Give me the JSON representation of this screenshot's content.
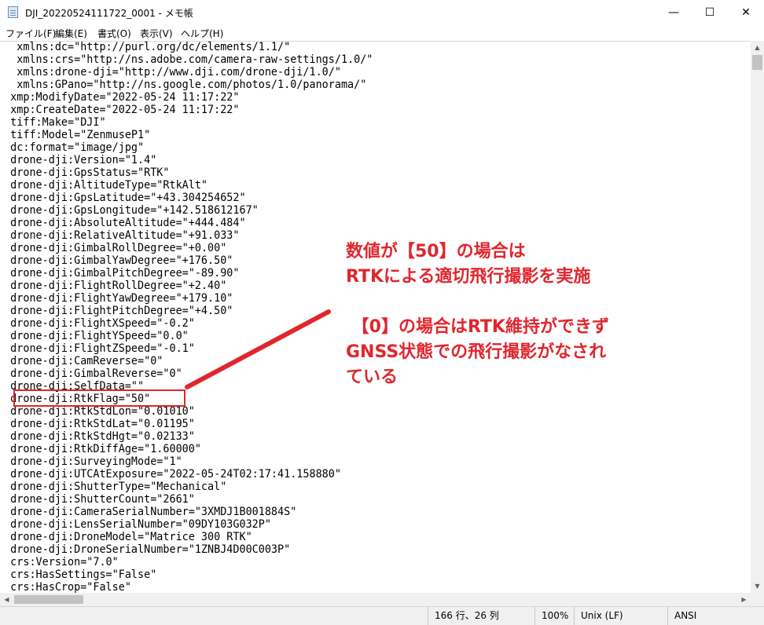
{
  "window": {
    "title": "DJI_20220524111722_0001 - メモ帳",
    "minimize_glyph": "—",
    "maximize_glyph": "☐",
    "close_glyph": "✕"
  },
  "menu": [
    {
      "label": "ファイル(F)"
    },
    {
      "label": "編集(E)"
    },
    {
      "label": "書式(O)"
    },
    {
      "label": "表示(V)"
    },
    {
      "label": "ヘルプ(H)"
    }
  ],
  "lines": [
    "   xmlns:dc=\"http://purl.org/dc/elements/1.1/\"",
    "   xmlns:crs=\"http://ns.adobe.com/camera-raw-settings/1.0/\"",
    "   xmlns:drone-dji=\"http://www.dji.com/drone-dji/1.0/\"",
    "   xmlns:GPano=\"http://ns.google.com/photos/1.0/panorama/\"",
    "  xmp:ModifyDate=\"2022-05-24 11:17:22\"",
    "  xmp:CreateDate=\"2022-05-24 11:17:22\"",
    "  tiff:Make=\"DJI\"",
    "  tiff:Model=\"ZenmuseP1\"",
    "  dc:format=\"image/jpg\"",
    "  drone-dji:Version=\"1.4\"",
    "  drone-dji:GpsStatus=\"RTK\"",
    "  drone-dji:AltitudeType=\"RtkAlt\"",
    "  drone-dji:GpsLatitude=\"+43.304254652\"",
    "  drone-dji:GpsLongitude=\"+142.518612167\"",
    "  drone-dji:AbsoluteAltitude=\"+444.484\"",
    "  drone-dji:RelativeAltitude=\"+91.033\"",
    "  drone-dji:GimbalRollDegree=\"+0.00\"",
    "  drone-dji:GimbalYawDegree=\"+176.50\"",
    "  drone-dji:GimbalPitchDegree=\"-89.90\"",
    "  drone-dji:FlightRollDegree=\"+2.40\"",
    "  drone-dji:FlightYawDegree=\"+179.10\"",
    "  drone-dji:FlightPitchDegree=\"+4.50\"",
    "  drone-dji:FlightXSpeed=\"-0.2\"",
    "  drone-dji:FlightYSpeed=\"0.0\"",
    "  drone-dji:FlightZSpeed=\"-0.1\"",
    "  drone-dji:CamReverse=\"0\"",
    "  drone-dji:GimbalReverse=\"0\"",
    "  drone-dji:SelfData=\"\"",
    "  drone-dji:RtkFlag=\"50\"",
    "  drone-dji:RtkStdLon=\"0.01010\"",
    "  drone-dji:RtkStdLat=\"0.01195\"",
    "  drone-dji:RtkStdHgt=\"0.02133\"",
    "  drone-dji:RtkDiffAge=\"1.60000\"",
    "  drone-dji:SurveyingMode=\"1\"",
    "  drone-dji:UTCAtExposure=\"2022-05-24T02:17:41.158880\"",
    "  drone-dji:ShutterType=\"Mechanical\"",
    "  drone-dji:ShutterCount=\"2661\"",
    "  drone-dji:CameraSerialNumber=\"3XMDJ1B001884S\"",
    "  drone-dji:LensSerialNumber=\"09DY103G032P\"",
    "  drone-dji:DroneModel=\"Matrice 300 RTK\"",
    "  drone-dji:DroneSerialNumber=\"1ZNBJ4D00C003P\"",
    "  crs:Version=\"7.0\"",
    "  crs:HasSettings=\"False\"",
    "  crs:HasCrop=\"False\""
  ],
  "annotation": {
    "lines": [
      "数値が【50】の場合は",
      "RTKによる適切飛行撮影を実施",
      "",
      " 【0】の場合はRTK維持ができず",
      "GNSS状態での飛行撮影がなされ",
      "ている"
    ],
    "color": "#e0262e"
  },
  "status": {
    "position": "166 行、26 列",
    "zoom": "100%",
    "line_ending": "Unix (LF)",
    "encoding": "ANSI"
  }
}
